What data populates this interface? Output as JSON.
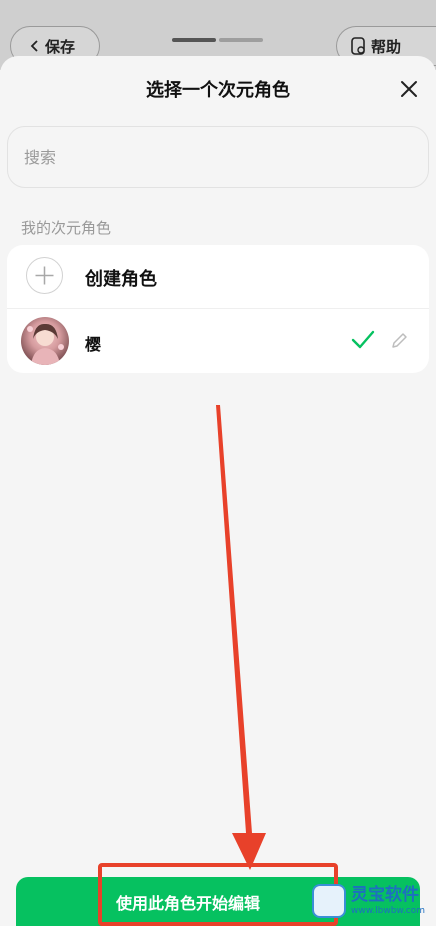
{
  "background": {
    "save_label": "保存",
    "help_label": "帮助"
  },
  "sheet": {
    "title": "选择一个次元角色",
    "search_placeholder": "搜索",
    "section_label": "我的次元角色",
    "create_label": "创建角色",
    "characters": [
      {
        "name": "樱",
        "selected": true
      }
    ],
    "primary_button": "使用此角色开始编辑"
  },
  "watermark": {
    "title": "灵宝软件",
    "url": "www.lbwbw.com"
  },
  "colors": {
    "accent_green": "#06c160",
    "annotation_red": "#e8412a"
  }
}
